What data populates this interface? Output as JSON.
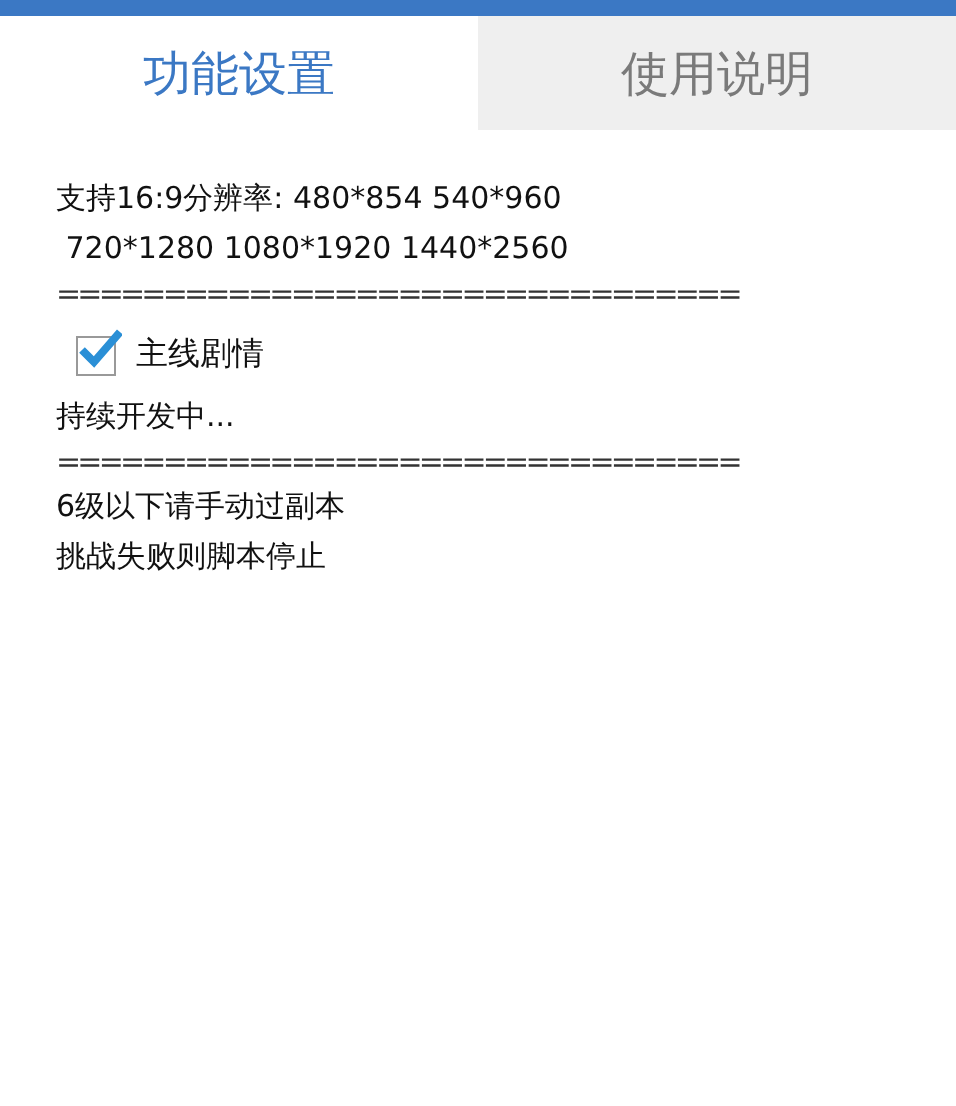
{
  "tabs": [
    {
      "label": "功能设置",
      "selected": true
    },
    {
      "label": "使用说明",
      "selected": false
    }
  ],
  "content": [
    {
      "kind": "text",
      "text": "支持16:9分辨率: 480*854 540*960\n 720*1280 1080*1920 1440*2560"
    },
    {
      "kind": "divider",
      "text": "================================"
    },
    {
      "kind": "checkbox",
      "text": "主线剧情",
      "checked": true
    },
    {
      "kind": "text",
      "text": "持续开发中..."
    },
    {
      "kind": "divider",
      "text": "================================"
    },
    {
      "kind": "text",
      "text": "6级以下请手动过副本"
    },
    {
      "kind": "text",
      "text": "挑战失败则脚本停止"
    }
  ]
}
